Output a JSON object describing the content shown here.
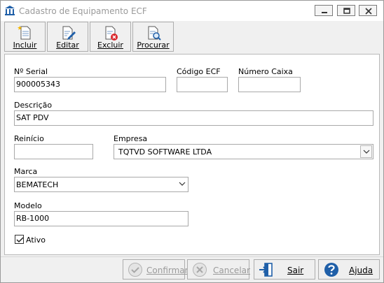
{
  "window": {
    "title": "Cadastro de Equipamento ECF"
  },
  "toolbar": {
    "incluir_label": "Incluir",
    "editar_label": "Editar",
    "excluir_label": "Excluir",
    "procurar_label": "Procurar"
  },
  "form": {
    "serial_label": "Nº Serial",
    "serial_value": "900005343",
    "codigo_label": "Código ECF",
    "codigo_value": "",
    "caixa_label": "Número Caixa",
    "caixa_value": "",
    "descricao_label": "Descrição",
    "descricao_value": "SAT PDV",
    "reinicio_label": "Reinício",
    "reinicio_value": "",
    "empresa_label": "Empresa",
    "empresa_value": "TQTVD SOFTWARE LTDA",
    "marca_label": "Marca",
    "marca_value": "BEMATECH",
    "modelo_label": "Modelo",
    "modelo_value": "RB-1000",
    "ativo_label": "Ativo",
    "ativo_checked": true
  },
  "footer": {
    "confirmar_label": "Confirmar",
    "cancelar_label": "Cancelar",
    "sair_label": "Sair",
    "ajuda_label": "Ajuda"
  },
  "icons": {
    "app": "bank-icon",
    "incluir": "new-document-icon",
    "editar": "edit-document-icon",
    "excluir": "delete-document-icon",
    "procurar": "search-document-icon",
    "confirmar": "check-circle-icon",
    "cancelar": "x-circle-icon",
    "sair": "exit-door-icon",
    "ajuda": "help-icon"
  },
  "colors": {
    "accent": "#1f5fa8",
    "disabled_text": "#9a9a9a",
    "delete_red": "#d9262c"
  }
}
